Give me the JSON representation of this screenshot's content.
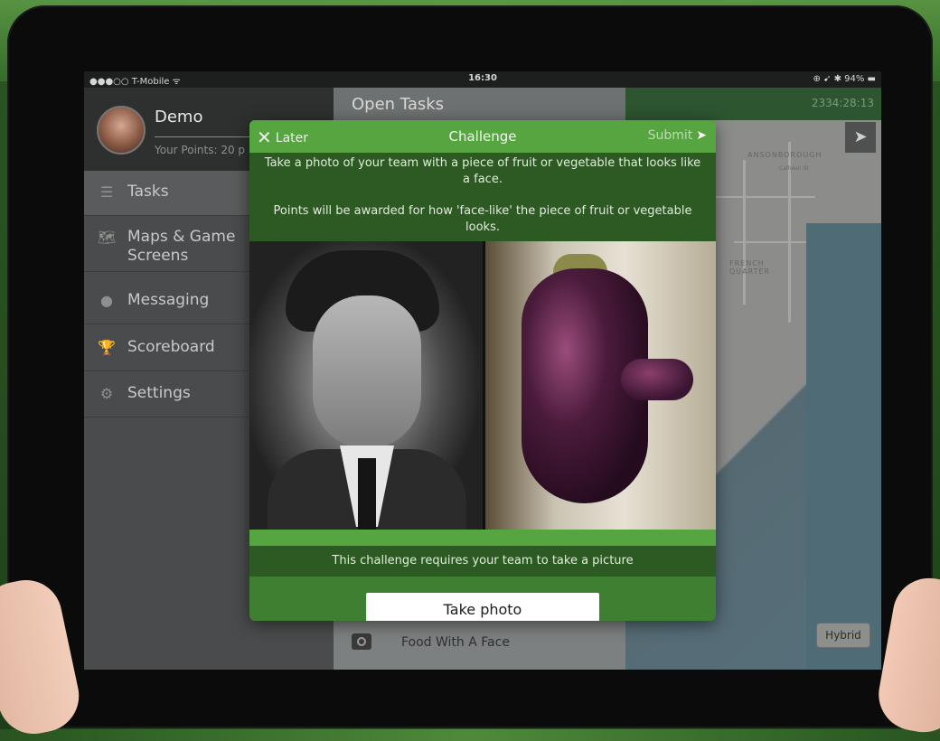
{
  "status_bar": {
    "carrier": "●●●○○ T-Mobile ᯤ",
    "time": "16:30",
    "battery": "⊕ ➹ ✱ 94% ▬"
  },
  "sidebar": {
    "profile": {
      "name": "Demo",
      "points_label": "Your Points: 20 p"
    },
    "items": [
      {
        "label": "Tasks",
        "icon": "list-icon",
        "glyph": "☰"
      },
      {
        "label": "Maps & Game\nScreens",
        "icon": "map-icon",
        "glyph": "🗺"
      },
      {
        "label": "Messaging",
        "icon": "chat-bubble-icon",
        "glyph": "●"
      },
      {
        "label": "Scoreboard",
        "icon": "trophy-icon",
        "glyph": "🏆"
      },
      {
        "label": "Settings",
        "icon": "gear-icon",
        "glyph": "⚙"
      }
    ]
  },
  "middle": {
    "title": "Open Tasks",
    "task": {
      "label": "Food With A Face",
      "icon": "camera-icon"
    }
  },
  "map": {
    "timer": "2334:28:13",
    "labels": {
      "district_top": "ANSONBOROUGH",
      "district_mid": "FRENCH\nQUARTER",
      "street": "Calhoun St"
    },
    "hybrid_label": "Hybrid",
    "nav_glyph": "➤"
  },
  "modal": {
    "later_label": "Later",
    "title": "Challenge",
    "submit_label": "Submit",
    "description_1": "Take a photo of your team with a piece of fruit or vegetable that looks like a face.",
    "description_2": "Points will be awarded for how 'face-like' the piece of fruit or vegetable looks.",
    "requirement": "This challenge requires your team to take a picture",
    "take_photo_label": "Take photo"
  },
  "colors": {
    "accent_green": "#56a541",
    "dark_green": "#2d5a22"
  }
}
